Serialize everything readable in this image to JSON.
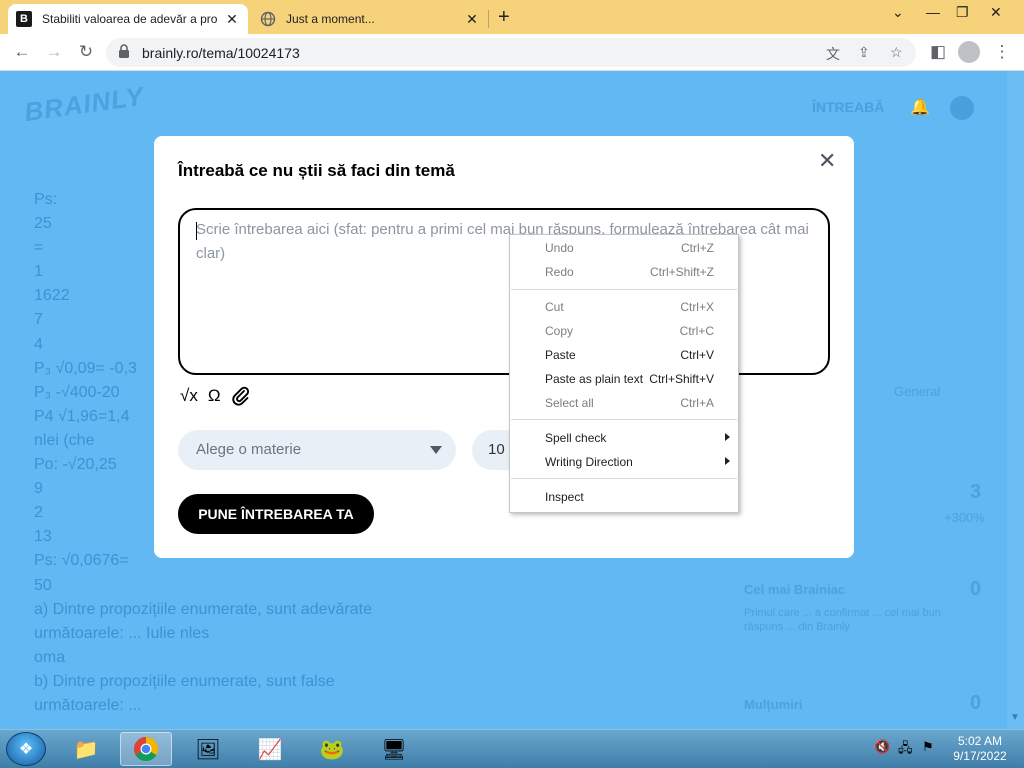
{
  "browser": {
    "tabs": [
      {
        "title": "Stabiliti valoarea de adevăr a pro",
        "active": true
      },
      {
        "title": "Just a moment...",
        "active": false
      }
    ],
    "url": "brainly.ro/tema/10024173"
  },
  "background_page": {
    "logo": "BRAINLY",
    "ask_button": "ÎNTREABĂ",
    "question_lines": [
      "Ps:",
      "25",
      "=",
      "1",
      "1622",
      "7",
      "4",
      "P₃ √0,09= -0,3",
      "P₃ -√400-20",
      "P4 √1,96=1,4",
      "nlei (che",
      "Po: -√20,25",
      "9",
      "2",
      "13",
      "Ps: √0,0676=",
      "50",
      "a) Dintre propozițiile enumerate, sunt adevărate",
      "următoarele: ... Iulie nles",
      "oma",
      "b) Dintre propozițiile enumerate, sunt false",
      "următoarele: ..."
    ],
    "sidebar": {
      "general": "General",
      "count_3": "3",
      "pct": "+300%",
      "best_title": "Cel mai Brainiac",
      "best_count": "0",
      "best_desc": "Primul care ... a confirmat ... cel mai bun răspuns ... din Brainly",
      "thanks_title": "Mulțumiri",
      "thanks_count": "0"
    }
  },
  "modal": {
    "title": "Întreabă ce nu știi să faci din temă",
    "placeholder": "Scrie întrebarea aici (sfat: pentru a primi cel mai bun răspuns, formulează întrebarea cât mai clar)",
    "tool_icons": [
      "√x",
      "Ω",
      "📎"
    ],
    "subject_placeholder": "Alege o materie",
    "points_value": "10",
    "submit": "PUNE ÎNTREBAREA TA"
  },
  "context_menu": {
    "items": [
      {
        "label": "Undo",
        "shortcut": "Ctrl+Z",
        "disabled": true
      },
      {
        "label": "Redo",
        "shortcut": "Ctrl+Shift+Z",
        "disabled": true
      },
      {
        "label": "Cut",
        "shortcut": "Ctrl+X",
        "disabled": true
      },
      {
        "label": "Copy",
        "shortcut": "Ctrl+C",
        "disabled": true
      },
      {
        "label": "Paste",
        "shortcut": "Ctrl+V",
        "disabled": false
      },
      {
        "label": "Paste as plain text",
        "shortcut": "Ctrl+Shift+V",
        "disabled": false
      },
      {
        "label": "Select all",
        "shortcut": "Ctrl+A",
        "disabled": true
      },
      {
        "label": "Spell check",
        "shortcut": "",
        "submenu": true
      },
      {
        "label": "Writing Direction",
        "shortcut": "",
        "submenu": true
      },
      {
        "label": "Inspect",
        "shortcut": ""
      }
    ]
  },
  "taskbar": {
    "time": "5:02 AM",
    "date": "9/17/2022"
  }
}
